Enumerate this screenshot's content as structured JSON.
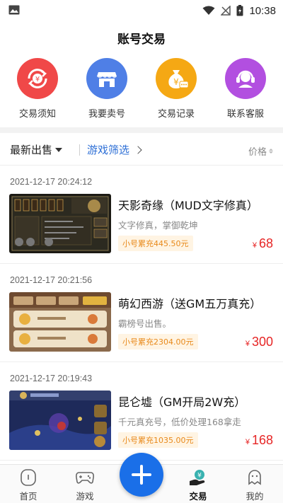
{
  "status": {
    "time": "10:38"
  },
  "header": {
    "title": "账号交易"
  },
  "actions": [
    {
      "label": "交易须知",
      "color": "#f04848"
    },
    {
      "label": "我要卖号",
      "color": "#4f7fe6"
    },
    {
      "label": "交易记录",
      "color": "#f5a814"
    },
    {
      "label": "联系客服",
      "color": "#b24fe0"
    }
  ],
  "filter": {
    "latest": "最新出售",
    "game_filter": "游戏筛选",
    "price": "价格"
  },
  "listings": [
    {
      "date": "2021-12-17 20:24:12",
      "name": "天影奇缘（MUD文字修真）",
      "desc": "文字修真，掌御乾坤",
      "tag": "小号累充445.50元",
      "currency": "¥",
      "price": "68"
    },
    {
      "date": "2021-12-17 20:21:56",
      "name": "萌幻西游（送GM五万真充）",
      "desc": "霸榜号出售。",
      "tag": "小号累充2304.00元",
      "currency": "¥",
      "price": "300"
    },
    {
      "date": "2021-12-17 20:19:43",
      "name": "昆仑墟（GM开局2W充）",
      "desc": "千元真充号，低价处理168拿走",
      "tag": "小号累充1035.00元",
      "currency": "¥",
      "price": "168"
    }
  ],
  "nav": {
    "home": "首页",
    "game": "游戏",
    "trade": "交易",
    "mine": "我的"
  }
}
